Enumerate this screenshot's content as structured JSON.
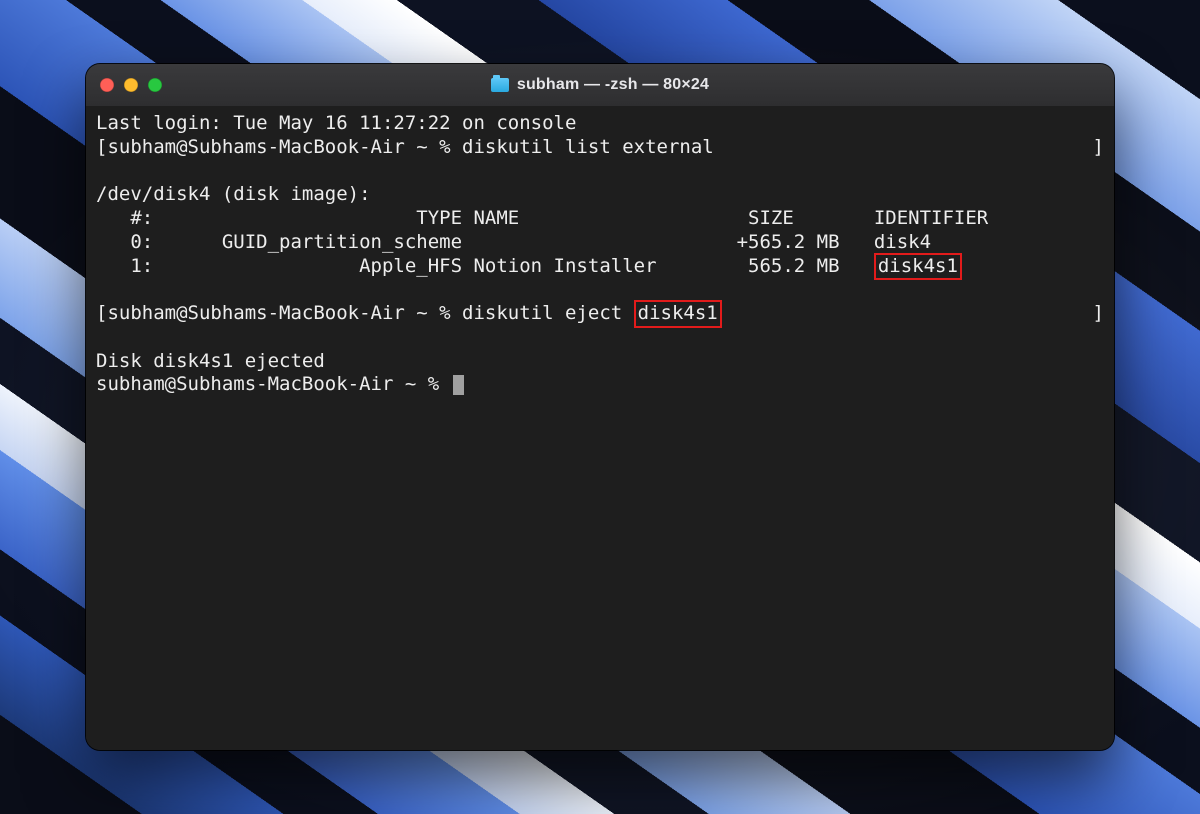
{
  "window": {
    "title": "subham — -zsh — 80×24"
  },
  "term": {
    "last_login": "Last login: Tue May 16 11:27:22 on console",
    "prompt1_left": "[subham@Subhams-MacBook-Air ~ % diskutil list external",
    "prompt1_right": "]",
    "disk_header": "/dev/disk4 (disk image):",
    "col_head": "   #:                       TYPE NAME                    SIZE       IDENTIFIER",
    "row0": "   0:      GUID_partition_scheme                        +565.2 MB   disk4",
    "row1_before": "   1:                  Apple_HFS Notion Installer        565.2 MB   ",
    "row1_hl": "disk4s1",
    "blank": "",
    "prompt2_left": "[subham@Subhams-MacBook-Air ~ % diskutil eject ",
    "prompt2_hl": "disk4s1",
    "prompt2_right": "]",
    "ejected": "Disk disk4s1 ejected",
    "prompt3": "subham@Subhams-MacBook-Air ~ % "
  }
}
